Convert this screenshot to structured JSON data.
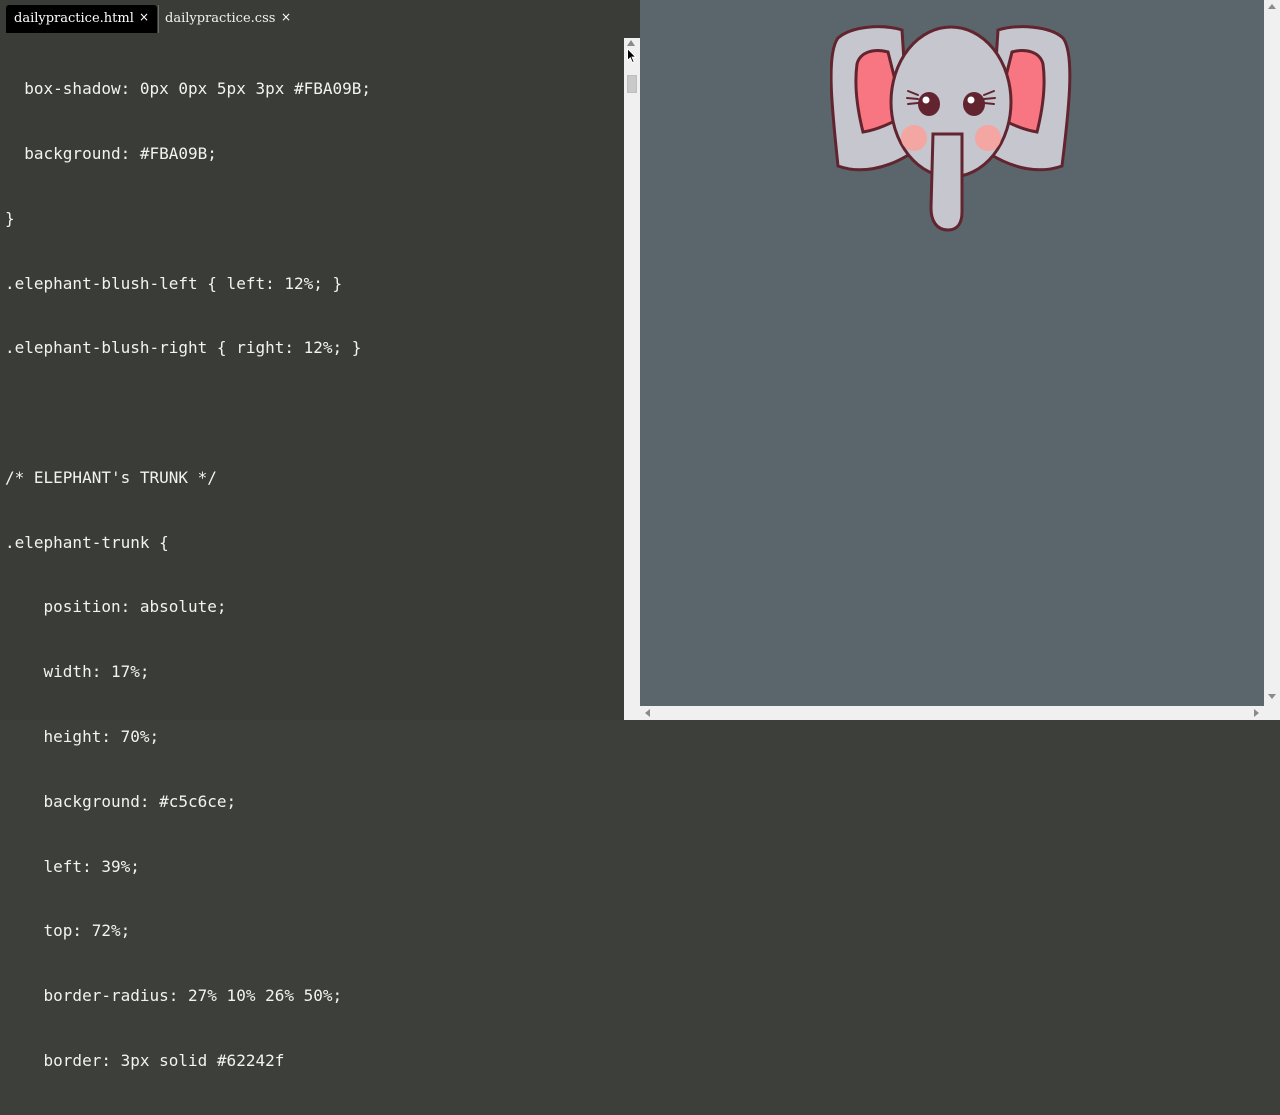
{
  "tabs": [
    {
      "label": "dailypractice.html",
      "active": true,
      "close": "×"
    },
    {
      "label": "dailypractice.css",
      "active": false,
      "close": "×"
    }
  ],
  "code_lines": [
    "  box-shadow: 0px 0px 5px 3px #FBA09B;",
    "  background: #FBA09B;",
    "}",
    ".elephant-blush-left { left: 12%; }",
    ".elephant-blush-right { right: 12%; }",
    "",
    "/* ELEPHANT's TRUNK */",
    ".elephant-trunk {",
    "    position: absolute;",
    "    width: 17%;",
    "    height: 70%;",
    "    background: #c5c6ce;",
    "    left: 39%;",
    "    top: 72%;",
    "    border-radius: 27% 10% 26% 50%;",
    "    border: 3px solid #62242f"
  ],
  "colors": {
    "editor_bg": "#3a3c37",
    "editor_text": "#f3f3ee",
    "preview_bg": "#5a666b",
    "elephant_gray": "#c5c6ce",
    "elephant_outline": "#62242f",
    "ear_inner": "#f87682",
    "blush": "#fba09b"
  },
  "icons": {
    "cursor": "mouse-pointer-icon",
    "elephant": "elephant-drawing"
  }
}
